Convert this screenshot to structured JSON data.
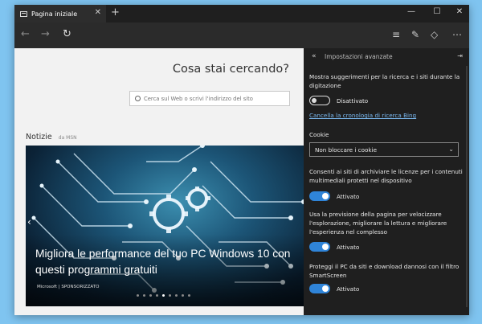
{
  "tab": {
    "title": "Pagina iniziale",
    "close": "✕"
  },
  "window": {
    "new_tab": "+",
    "minimize": "—",
    "maximize": "☐",
    "close": "✕"
  },
  "nav": {
    "back": "←",
    "forward": "→",
    "refresh": "↻"
  },
  "page": {
    "heading": "Cosa stai cercando?",
    "search_placeholder": "Cerca sul Web o scrivi l'indirizzo del sito",
    "news_title": "Notizie",
    "news_source": "da MSN",
    "hero": {
      "title": "Migliora le performance del tuo PC Windows 10 con questi programmi gratuiti",
      "credit": "Microsoft | SPONSORIZZATO",
      "slide_count": 9,
      "active_slide": 4
    }
  },
  "settings": {
    "title": "Impostazioni avanzate",
    "suggestions_text": "Mostra suggerimenti per la ricerca e i siti durante la digitazione",
    "suggestions_state": "Disattivato",
    "clear_history_link": "Cancella la cronologia di ricerca Bing",
    "cookies_label": "Cookie",
    "cookies_value": "Non bloccare i cookie",
    "licenses_text": "Consenti ai siti di archiviare le licenze per i contenuti multimediali protetti nel dispositivo",
    "licenses_state": "Attivato",
    "prediction_text": "Usa la previsione della pagina per velocizzare l'esplorazione, migliorare la lettura e migliorare l'esperienza nel complesso",
    "prediction_state": "Attivato",
    "smartscreen_text": "Proteggi il PC da siti e download dannosi con il filtro SmartScreen",
    "smartscreen_state": "Attivato"
  },
  "colors": {
    "accent": "#2f84d8",
    "link": "#7ab8ef",
    "panel_bg": "#1f1f1f",
    "desktop": "#7fc4f0"
  }
}
